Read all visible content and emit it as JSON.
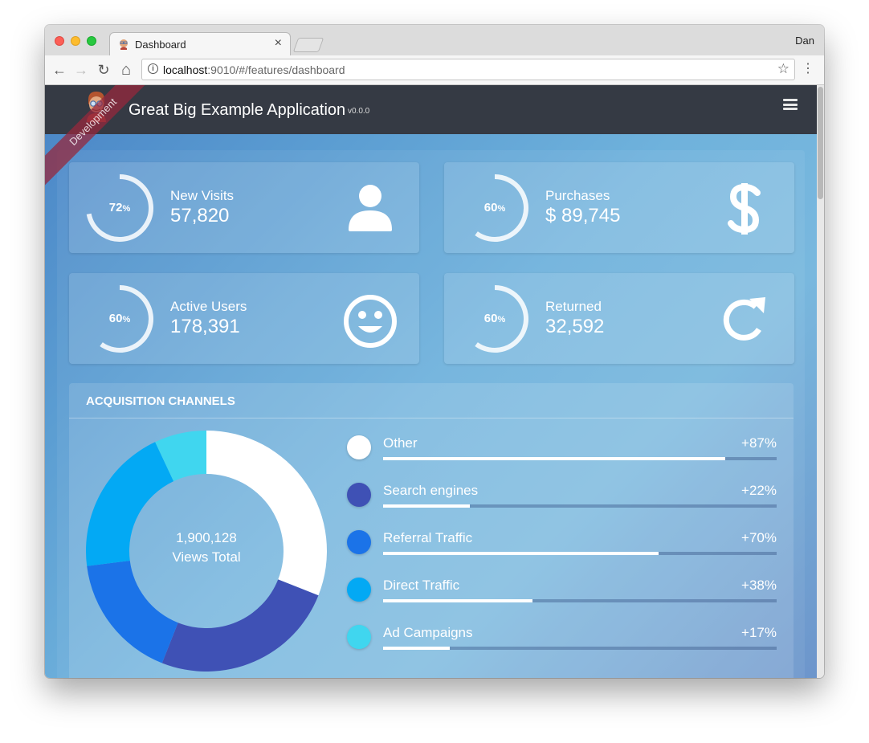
{
  "browser": {
    "tab_title": "Dashboard",
    "tab_close": "×",
    "user": "Dan",
    "url_host": "localhost",
    "url_rest": ":9010/#/features/dashboard",
    "back_glyph": "←",
    "forward_glyph": "→",
    "reload_glyph": "↻",
    "home_glyph": "⌂",
    "star_glyph": "☆",
    "menu_glyph": "⋮",
    "info_glyph": "i"
  },
  "app": {
    "title": "Great Big Example Application",
    "version": "v0.0.0",
    "ribbon": "Development"
  },
  "stats": [
    {
      "label": "New Visits",
      "value": "57,820",
      "percent": "72",
      "percent_sign": "%",
      "ring_fraction": 0.72,
      "icon": "user-icon"
    },
    {
      "label": "Purchases",
      "value": "$ 89,745",
      "percent": "60",
      "percent_sign": "%",
      "ring_fraction": 0.6,
      "icon": "dollar-icon"
    },
    {
      "label": "Active Users",
      "value": "178,391",
      "percent": "60",
      "percent_sign": "%",
      "ring_fraction": 0.6,
      "icon": "smiley-icon"
    },
    {
      "label": "Returned",
      "value": "32,592",
      "percent": "60",
      "percent_sign": "%",
      "ring_fraction": 0.6,
      "icon": "refresh-icon"
    }
  ],
  "acquisition": {
    "title": "ACQUISITION CHANNELS",
    "center_value": "1,900,128",
    "center_label": "Views Total",
    "channels": [
      {
        "name": "Other",
        "pct": "+87%",
        "bar_fraction": 0.87,
        "color": "#ffffff"
      },
      {
        "name": "Search engines",
        "pct": "+22%",
        "bar_fraction": 0.22,
        "color": "#3f51b5"
      },
      {
        "name": "Referral Traffic",
        "pct": "+70%",
        "bar_fraction": 0.7,
        "color": "#1b73e8"
      },
      {
        "name": "Direct Traffic",
        "pct": "+38%",
        "bar_fraction": 0.38,
        "color": "#03a9f4"
      },
      {
        "name": "Ad Campaigns",
        "pct": "+17%",
        "bar_fraction": 0.17,
        "color": "#40d6ef"
      }
    ]
  },
  "chart_data": {
    "type": "pie",
    "categories": [
      "Other",
      "Search engines",
      "Referral Traffic",
      "Direct Traffic",
      "Ad Campaigns"
    ],
    "values": [
      31,
      25,
      17,
      20,
      7
    ],
    "colors": [
      "#ffffff",
      "#3f51b5",
      "#1b73e8",
      "#03a9f4",
      "#40d6ef"
    ],
    "title": "ACQUISITION CHANNELS",
    "donut": true,
    "center_text": "1,900,128 Views Total"
  }
}
